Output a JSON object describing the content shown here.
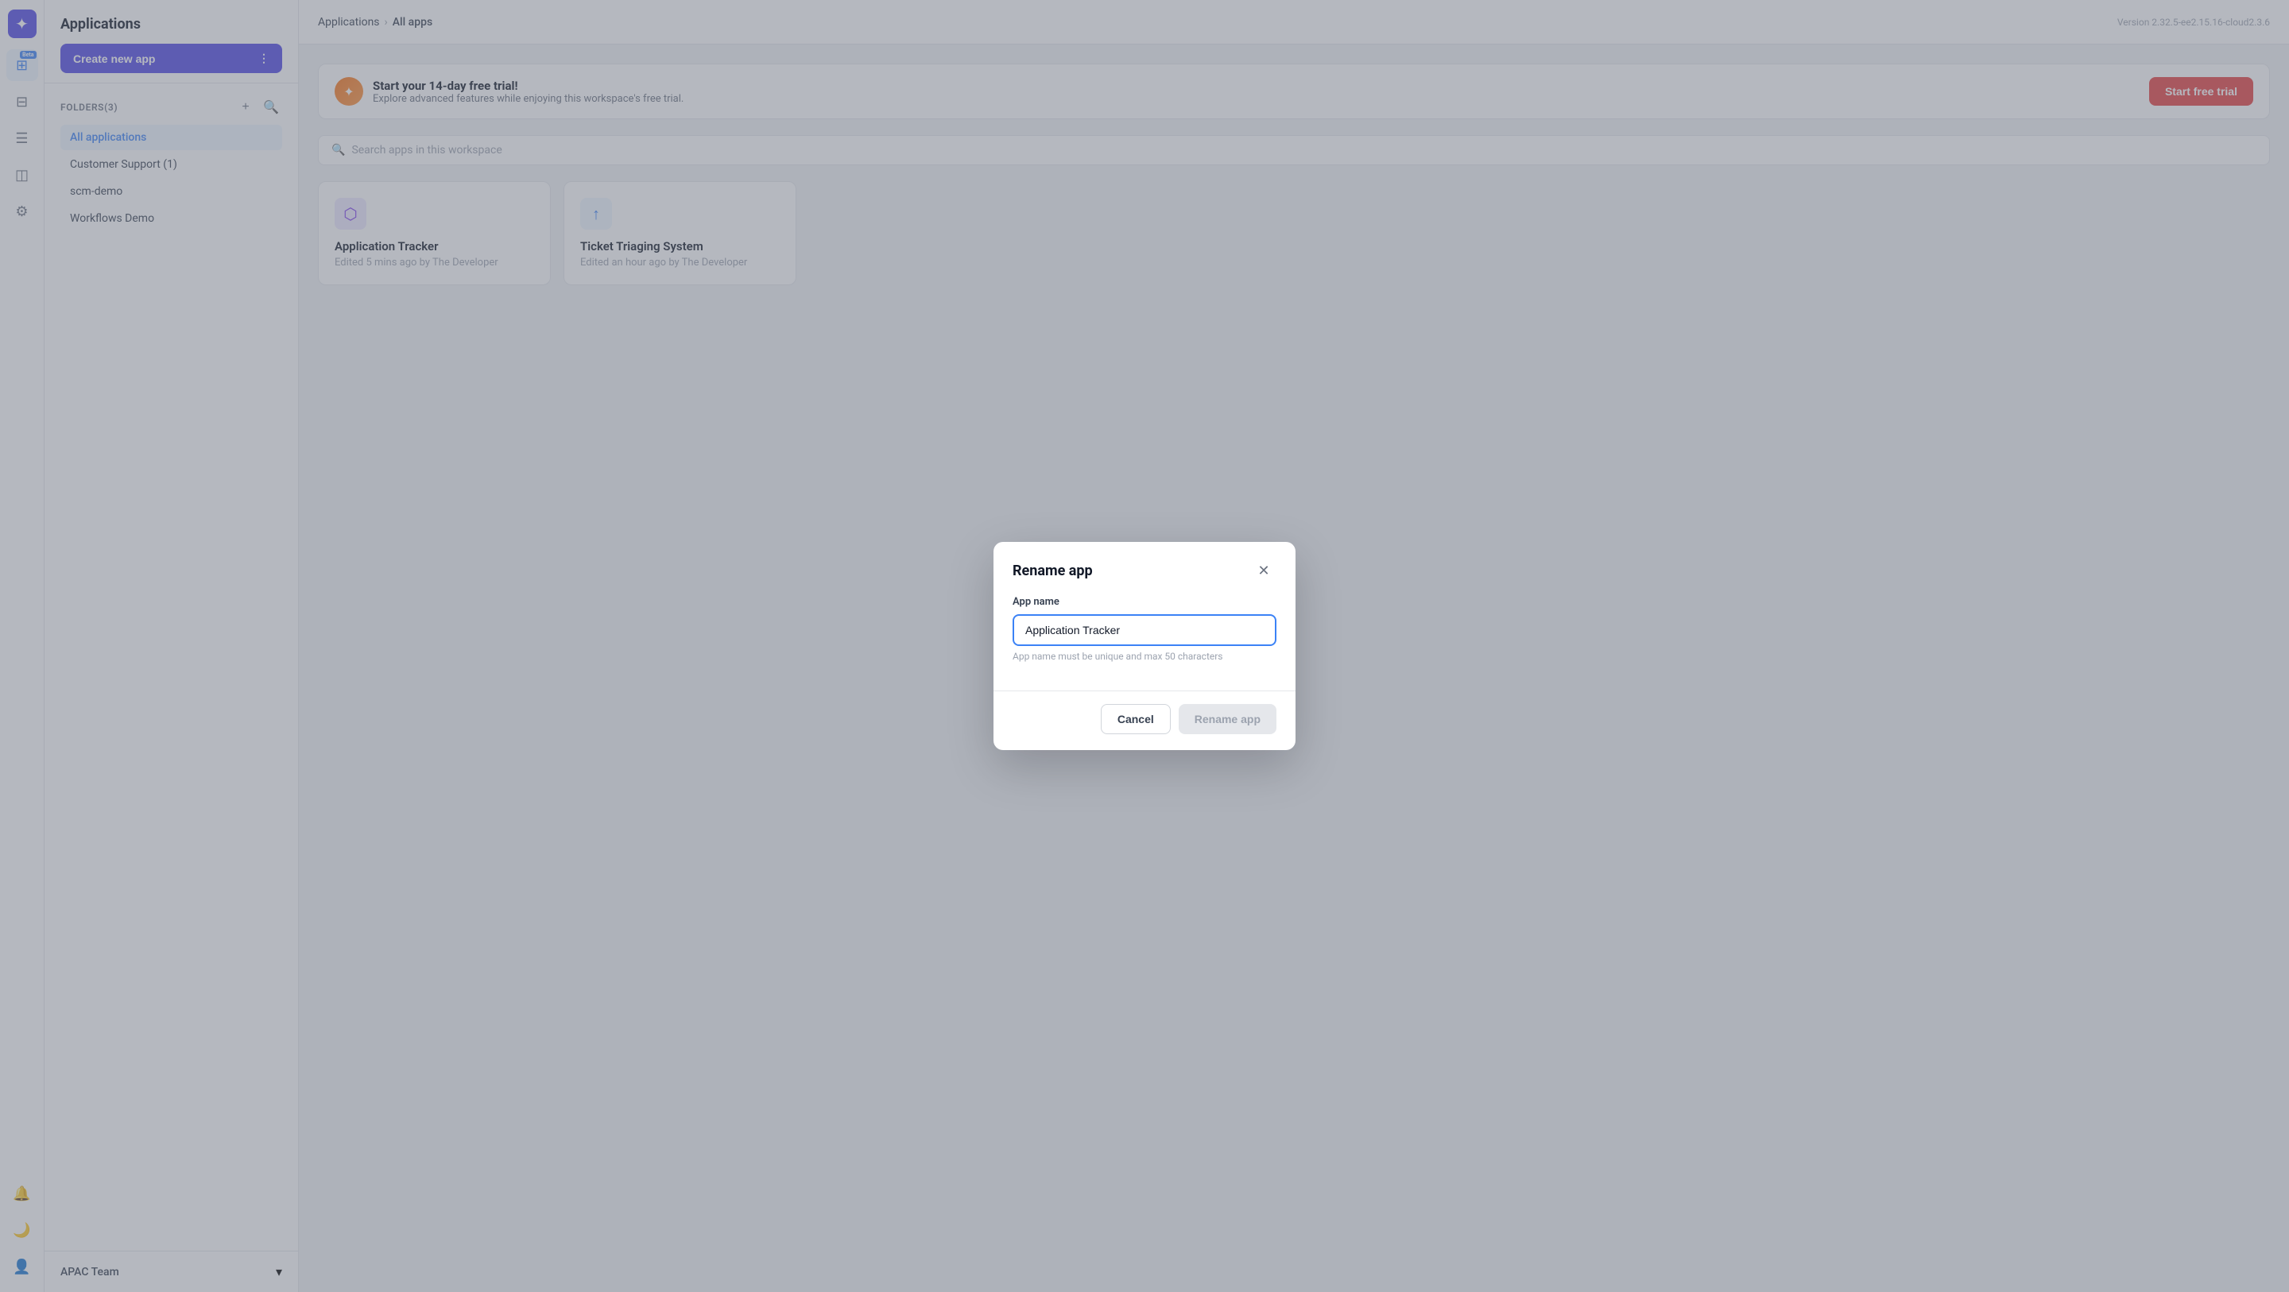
{
  "app": {
    "logo_icon": "✦",
    "sidebar_title": "Applications"
  },
  "icon_sidebar": {
    "items": [
      {
        "name": "apps-icon",
        "icon": "⊞",
        "active": true,
        "beta": true
      },
      {
        "name": "dashboard-icon",
        "icon": "⊟",
        "active": false
      },
      {
        "name": "table-icon",
        "icon": "≡",
        "active": false
      },
      {
        "name": "layers-icon",
        "icon": "◫",
        "active": false
      },
      {
        "name": "settings-icon",
        "icon": "⚙",
        "active": false
      }
    ],
    "bottom_items": [
      {
        "name": "bell-icon",
        "icon": "🔔"
      },
      {
        "name": "moon-icon",
        "icon": "🌙"
      },
      {
        "name": "user-icon",
        "icon": "👤"
      }
    ]
  },
  "left_panel": {
    "title": "Applications",
    "create_button_label": "Create new app",
    "folders_label": "FOLDERS(3)",
    "folders": [
      {
        "name": "All applications",
        "active": true
      },
      {
        "name": "Customer Support (1)",
        "active": false
      },
      {
        "name": "scm-demo",
        "active": false
      },
      {
        "name": "Workflows Demo",
        "active": false
      }
    ],
    "footer": {
      "team_name": "APAC Team",
      "chevron_icon": "▾"
    }
  },
  "header": {
    "breadcrumb": {
      "parent": "Applications",
      "separator": "›",
      "current": "All apps"
    },
    "version": "Version 2.32.5-ee2.15.16-cloud2.3.6"
  },
  "trial_banner": {
    "icon": "✦",
    "title": "Start your 14-day free trial!",
    "subtitle": "Explore advanced features while enjoying this workspace's free trial.",
    "button_label": "Start free trial"
  },
  "search": {
    "placeholder": "Search apps in this workspace",
    "icon": "🔍"
  },
  "apps": [
    {
      "name": "Application Tracker",
      "meta": "Edited 5 mins ago by The Developer",
      "icon_color": "purple",
      "icon": "⬡"
    },
    {
      "name": "Ticket Triaging System",
      "meta": "Edited an hour ago by The Developer",
      "icon_color": "blue",
      "icon": "↑"
    }
  ],
  "modal": {
    "title": "Rename app",
    "close_icon": "✕",
    "form_label": "App name",
    "input_value": "Application Tracker",
    "hint": "App name must be unique and max 50 characters",
    "cancel_label": "Cancel",
    "rename_label": "Rename app"
  }
}
